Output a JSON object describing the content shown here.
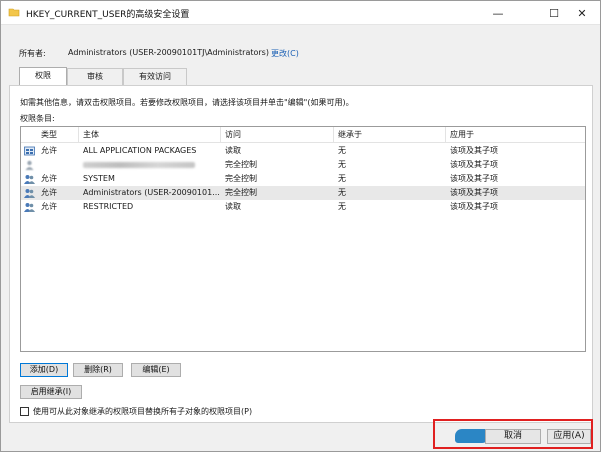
{
  "window": {
    "title": "HKEY_CURRENT_USER的高级安全设置",
    "minimize_glyph": "—",
    "maximize_glyph": "☐",
    "close_glyph": "✕"
  },
  "owner": {
    "label": "所有者:",
    "value": "Administrators (USER-20090101TJ\\Administrators)",
    "change_link": "更改(C)"
  },
  "tabs": [
    {
      "label": "权限",
      "active": true
    },
    {
      "label": "审核",
      "active": false
    },
    {
      "label": "有效访问",
      "active": false
    }
  ],
  "panel": {
    "instruction": "如需其他信息，请双击权限项目。若要修改权限项目，请选择该项目并单击\"编辑\"(如果可用)。",
    "entries_label": "权限条目:"
  },
  "table": {
    "headers": [
      "类型",
      "主体",
      "访问",
      "继承于",
      "应用于"
    ],
    "rows": [
      {
        "icon": "app-packages-icon",
        "type": "允许",
        "principal": "ALL APPLICATION PACKAGES",
        "access": "读取",
        "inherited_from": "无",
        "applies_to": "该项及其子项",
        "blurred": false,
        "selected": false
      },
      {
        "icon": "user-icon",
        "type": "",
        "principal": "",
        "access": "完全控制",
        "inherited_from": "无",
        "applies_to": "该项及其子项",
        "blurred": true,
        "selected": false
      },
      {
        "icon": "users-icon",
        "type": "允许",
        "principal": "SYSTEM",
        "access": "完全控制",
        "inherited_from": "无",
        "applies_to": "该项及其子项",
        "blurred": false,
        "selected": false
      },
      {
        "icon": "users-icon",
        "type": "允许",
        "principal": "Administrators (USER-20090101...",
        "access": "完全控制",
        "inherited_from": "无",
        "applies_to": "该项及其子项",
        "blurred": false,
        "selected": true
      },
      {
        "icon": "users-icon",
        "type": "允许",
        "principal": "RESTRICTED",
        "access": "读取",
        "inherited_from": "无",
        "applies_to": "该项及其子项",
        "blurred": false,
        "selected": false
      }
    ]
  },
  "buttons": {
    "add": "添加(D)",
    "remove": "删除(R)",
    "edit": "编辑(E)",
    "enable_inheritance": "启用继承(I)",
    "cancel": "取消",
    "apply": "应用(A)"
  },
  "checkbox": {
    "label": "使用可从此对象继承的权限项目替换所有子对象的权限项目(P)",
    "checked": false
  },
  "colors": {
    "link": "#1a5fb4",
    "highlight_box": "#e02020",
    "selected_row": "#e8e8e8"
  }
}
